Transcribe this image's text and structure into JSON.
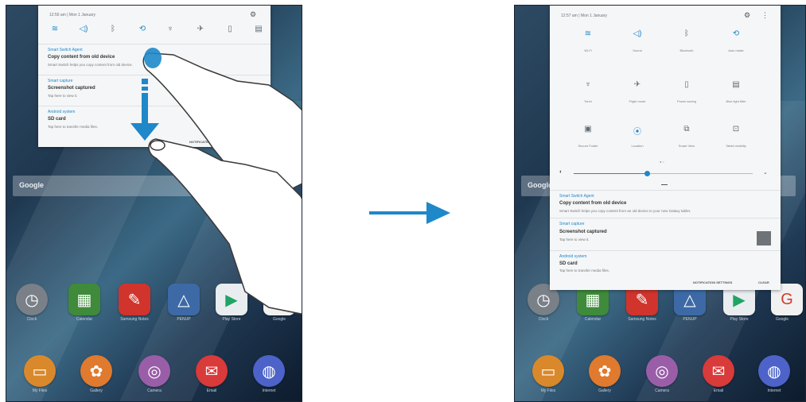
{
  "left_screen": {
    "status": {
      "time_date": "12:56 am  |  Mon 1 January"
    },
    "quick_icons": [
      "wifi-icon",
      "sound-icon",
      "bluetooth-icon",
      "auto-rotate-icon",
      "torch-icon",
      "airplane-icon",
      "power-saving-icon",
      "blue-light-filter-icon"
    ],
    "notifications": [
      {
        "app": "Smart Switch Agent",
        "title": "Copy content from old device",
        "body": "Smart Switch helps you copy content from old device."
      },
      {
        "app": "Smart capture",
        "title": "Screenshot captured",
        "body": "Tap here to view it."
      },
      {
        "app": "Android system",
        "title": "SD card",
        "body": "Tap here to transfer media files."
      }
    ],
    "notification_settings": "NOTIFICATION SETTINGS",
    "search_label": "Google",
    "apps_row1": [
      "Clock",
      "Calendar",
      "Samsung Notes",
      "PENUP",
      "Play Store",
      "Google"
    ],
    "apps_row2": [
      "My Files",
      "Gallery",
      "Camera",
      "Email",
      "Internet"
    ]
  },
  "right_screen": {
    "status": {
      "time_date": "12:57 am  |  Mon 1 January"
    },
    "quick_settings": [
      {
        "icon": "wifi-icon",
        "label": "Wi-Fi",
        "active": true
      },
      {
        "icon": "sound-icon",
        "label": "Sound",
        "active": true
      },
      {
        "icon": "bluetooth-icon",
        "label": "Bluetooth",
        "active": false
      },
      {
        "icon": "auto-rotate-icon",
        "label": "Auto rotate",
        "active": true
      },
      {
        "icon": "torch-icon",
        "label": "Torch",
        "active": false
      },
      {
        "icon": "airplane-icon",
        "label": "Flight mode",
        "active": false
      },
      {
        "icon": "power-saving-icon",
        "label": "Power saving",
        "active": false
      },
      {
        "icon": "blue-light-filter-icon",
        "label": "Blue light filter",
        "active": false
      },
      {
        "icon": "secure-folder-icon",
        "label": "Secure Folder",
        "active": false
      },
      {
        "icon": "location-icon",
        "label": "Location",
        "active": true
      },
      {
        "icon": "smart-view-icon",
        "label": "Smart View",
        "active": false
      },
      {
        "icon": "tablet-visibility-icon",
        "label": "Tablet visibility",
        "active": false
      }
    ],
    "brightness_level": 0.41,
    "notifications": [
      {
        "app": "Smart Switch Agent",
        "title": "Copy content from old device",
        "body": "Smart Switch helps you copy content from an old device to your new Galaxy tablet."
      },
      {
        "app": "Smart capture",
        "title": "Screenshot captured",
        "body": "Tap here to view it."
      },
      {
        "app": "Android system",
        "title": "SD card",
        "body": "Tap here to transfer media files."
      }
    ],
    "notification_settings": "NOTIFICATION SETTINGS",
    "clear": "CLEAR",
    "search_label": "Google",
    "apps_row1": [
      "Clock",
      "Calendar",
      "Samsung Notes",
      "PENUP",
      "Play Store",
      "Google"
    ],
    "apps_row2": [
      "My Files",
      "Gallery",
      "Camera",
      "Email",
      "Internet"
    ]
  },
  "colors": {
    "accent": "#1e88c9",
    "arrow": "#1e88c9",
    "panel": "#f5f6f7"
  }
}
